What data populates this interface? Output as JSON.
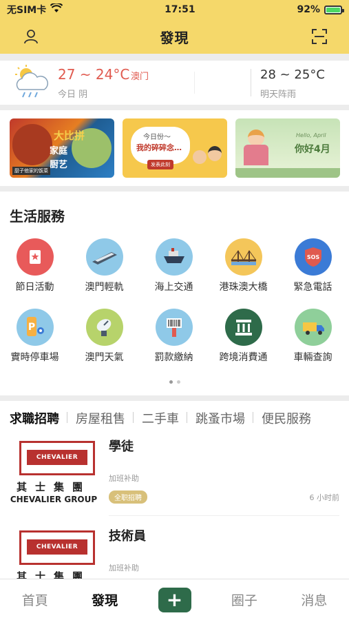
{
  "status": {
    "carrier": "无SIM卡",
    "time": "17:51",
    "battery": "92%",
    "battery_level": 0.92
  },
  "nav": {
    "title": "發現"
  },
  "weather": {
    "today_temp": "27 ~ 24°C",
    "city": "澳门",
    "today_desc": "今日 阴",
    "tomorrow_temp": "28 ~ 25°C",
    "tomorrow_desc": "明天阵雨"
  },
  "banners": [
    {
      "line1": "大比拼",
      "line2": "家庭",
      "line3": "厨艺",
      "tag": "厨子他家的饭菜"
    },
    {
      "line1": "今日份～",
      "line2": "我的碎碎念…",
      "button": "发表此刻"
    },
    {
      "line1": "Hello, April",
      "line2": "你好4月"
    }
  ],
  "services": {
    "heading": "生活服務",
    "items": [
      {
        "label": "節日活動",
        "icon": "festival-icon",
        "color": "#e85a5a"
      },
      {
        "label": "澳門輕軌",
        "icon": "light-rail-icon",
        "color": "#8fc9e8"
      },
      {
        "label": "海上交通",
        "icon": "ferry-icon",
        "color": "#8fc9e8"
      },
      {
        "label": "港珠澳大橋",
        "icon": "bridge-icon",
        "color": "#f4c65a"
      },
      {
        "label": "緊急電話",
        "icon": "sos-icon",
        "color": "#3b7bd6"
      },
      {
        "label": "實時停車場",
        "icon": "parking-icon",
        "color": "#8fc9e8"
      },
      {
        "label": "澳門天氣",
        "icon": "satellite-icon",
        "color": "#b7d36b"
      },
      {
        "label": "罰款繳納",
        "icon": "barcode-scanner-icon",
        "color": "#8fc9e8"
      },
      {
        "label": "跨境消費通",
        "icon": "court-icon",
        "color": "#2e6b4a"
      },
      {
        "label": "車輛查詢",
        "icon": "truck-icon",
        "color": "#8fcf9a"
      }
    ]
  },
  "tabs": [
    "求職招聘",
    "房屋租售",
    "二手車",
    "跳蚤市場",
    "便民服務"
  ],
  "jobs": [
    {
      "title": "學徒",
      "sub": "加班补助",
      "badge": "全职招聘",
      "time": "6 小时前",
      "logo_text": "CHEVALIER",
      "logo_cn": "其士集團",
      "logo_en": "CHEVALIER GROUP"
    },
    {
      "title": "技術員",
      "sub": "加班补助",
      "logo_text": "CHEVALIER",
      "logo_cn": "其士集團"
    }
  ],
  "tabbar": {
    "home": "首頁",
    "discover": "發現",
    "plus": "+",
    "circle": "圈子",
    "messages": "消息"
  }
}
